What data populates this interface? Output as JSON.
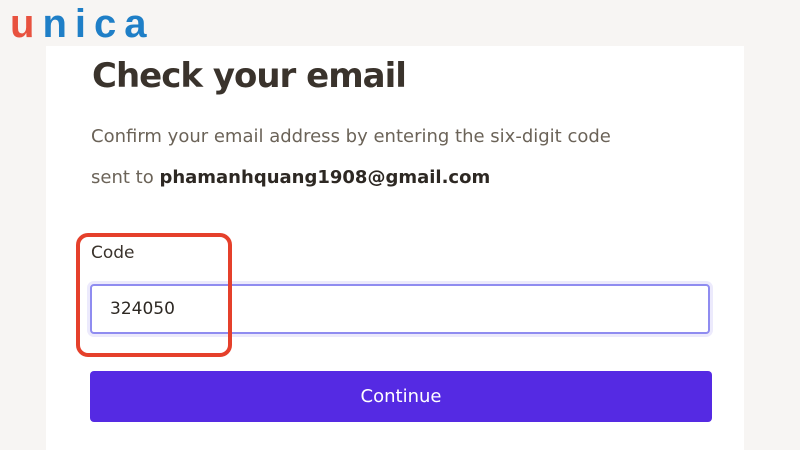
{
  "logo": {
    "first_letter": "u",
    "rest": "nica"
  },
  "page": {
    "title": "Check your email",
    "description_line1": "Confirm your email address by entering the six-digit code",
    "description_prefix": "sent to ",
    "email": "phamanhquang1908@gmail.com"
  },
  "form": {
    "code_label": "Code",
    "code_value": "324050",
    "continue_label": "Continue"
  },
  "colors": {
    "accent": "#552ae3",
    "highlight": "#e5402b",
    "logo_u": "#e8523f",
    "logo_rest": "#1f7fc7"
  }
}
